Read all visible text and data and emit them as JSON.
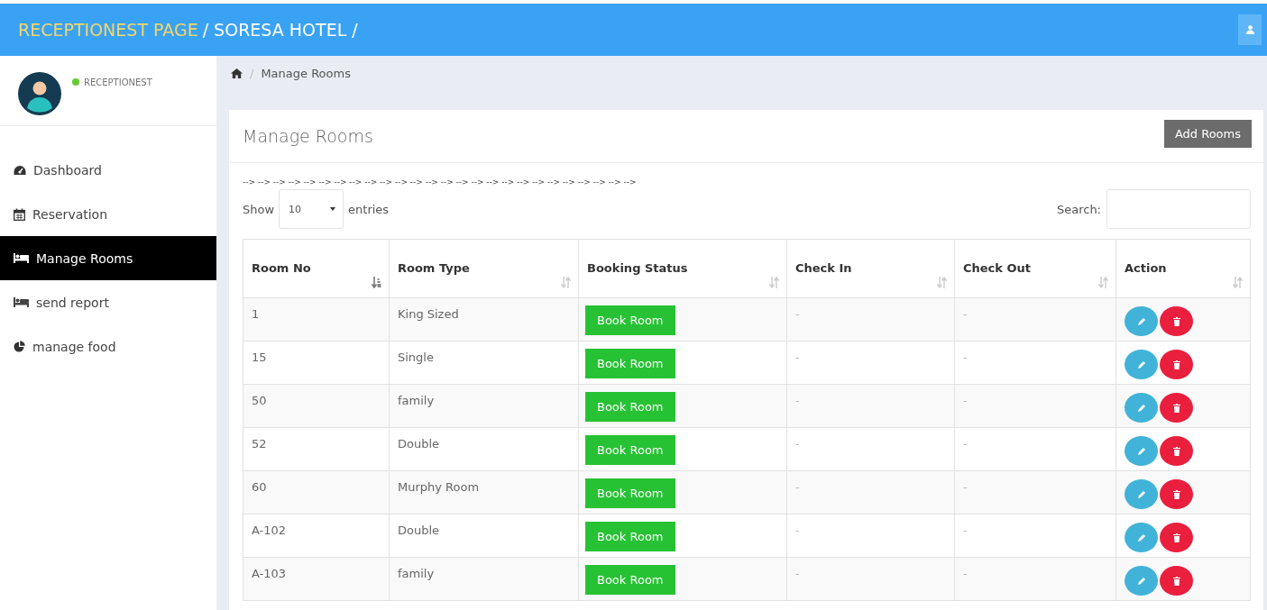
{
  "header": {
    "title": "RECEPTIONEST PAGE",
    "subtitle": "/ SORESA HOTEL /"
  },
  "sidebar": {
    "user": {
      "role": "RECEPTIONEST",
      "online": true
    },
    "items": [
      {
        "label": "Dashboard",
        "kind": "gauge",
        "selected": false
      },
      {
        "label": "Reservation",
        "kind": "calendar",
        "selected": false
      },
      {
        "label": "Manage Rooms",
        "kind": "bed",
        "selected": true
      },
      {
        "label": "send report",
        "kind": "bed",
        "selected": false
      },
      {
        "label": "manage food",
        "kind": "pie",
        "selected": false
      }
    ]
  },
  "breadcrumb": {
    "separator": "/",
    "current": "Manage Rooms"
  },
  "card": {
    "title": "Manage Rooms",
    "add_button": "Add Rooms",
    "stray_text": "--> --> --> --> --> --> --> --> --> --> --> --> --> --> --> --> --> --> --> --> --> --> --> --> --> -->",
    "show_label": "Show",
    "entries_value": "10",
    "entries_label": "entries",
    "search_label": "Search:"
  },
  "table": {
    "columns": [
      {
        "label": "Room No",
        "sorted": true
      },
      {
        "label": "Room Type",
        "sorted": false
      },
      {
        "label": "Booking Status",
        "sorted": false
      },
      {
        "label": "Check In",
        "sorted": false
      },
      {
        "label": "Check Out",
        "sorted": false
      },
      {
        "label": "Action",
        "sorted": false
      }
    ],
    "rows": [
      {
        "room_no": "1",
        "room_type": "King Sized",
        "booking": "Book Room",
        "check_in": "-",
        "check_out": "-"
      },
      {
        "room_no": "15",
        "room_type": "Single",
        "booking": "Book Room",
        "check_in": "-",
        "check_out": "-"
      },
      {
        "room_no": "50",
        "room_type": "family",
        "booking": "Book Room",
        "check_in": "-",
        "check_out": "-"
      },
      {
        "room_no": "52",
        "room_type": "Double",
        "booking": "Book Room",
        "check_in": "-",
        "check_out": "-"
      },
      {
        "room_no": "60",
        "room_type": "Murphy Room",
        "booking": "Book Room",
        "check_in": "-",
        "check_out": "-"
      },
      {
        "room_no": "A-102",
        "room_type": "Double",
        "booking": "Book Room",
        "check_in": "-",
        "check_out": "-"
      },
      {
        "room_no": "A-103",
        "room_type": "family",
        "booking": "Book Room",
        "check_in": "-",
        "check_out": "-"
      }
    ]
  }
}
